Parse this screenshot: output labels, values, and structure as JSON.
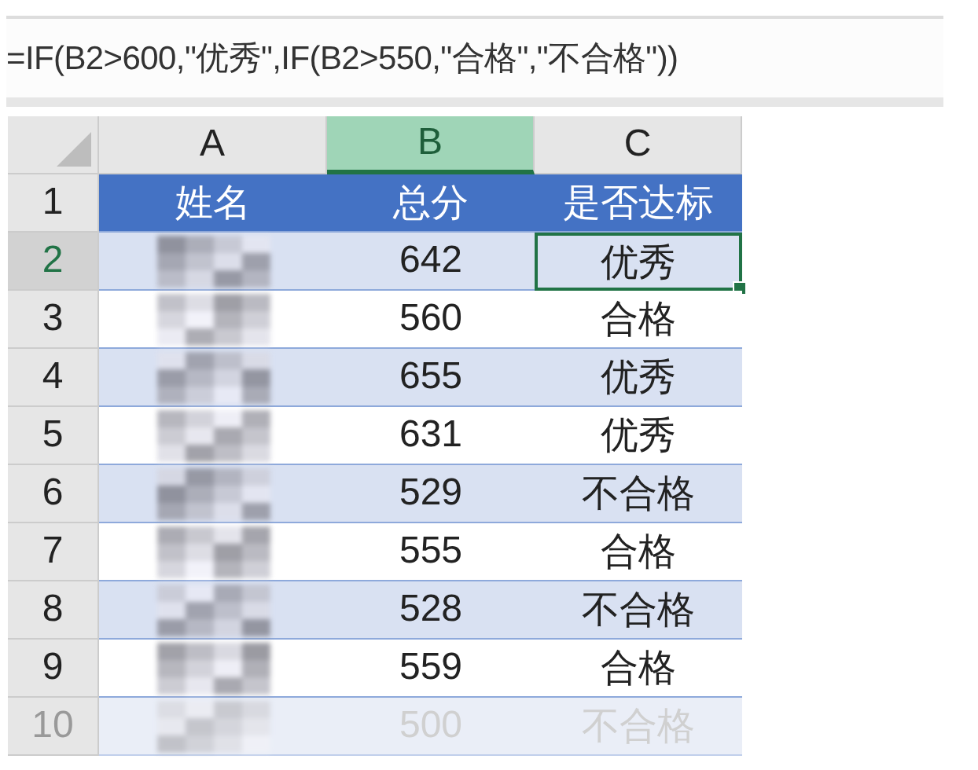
{
  "formula_bar": {
    "formula": "=IF(B2>600,\"优秀\",IF(B2>550,\"合格\",\"不合格\"))"
  },
  "columns": [
    {
      "label": "A",
      "selected": false
    },
    {
      "label": "B",
      "selected": true
    },
    {
      "label": "C",
      "selected": false
    }
  ],
  "header_row": {
    "number": "1",
    "cells": [
      "姓名",
      "总分",
      "是否达标"
    ]
  },
  "rows": [
    {
      "number": "2",
      "name_blurred": true,
      "score": "642",
      "result": "优秀",
      "selected": true,
      "faded": false
    },
    {
      "number": "3",
      "name_blurred": true,
      "score": "560",
      "result": "合格",
      "selected": false,
      "faded": false
    },
    {
      "number": "4",
      "name_blurred": true,
      "score": "655",
      "result": "优秀",
      "selected": false,
      "faded": false
    },
    {
      "number": "5",
      "name_blurred": true,
      "score": "631",
      "result": "优秀",
      "selected": false,
      "faded": false
    },
    {
      "number": "6",
      "name_blurred": true,
      "score": "529",
      "result": "不合格",
      "selected": false,
      "faded": false
    },
    {
      "number": "7",
      "name_blurred": true,
      "score": "555",
      "result": "合格",
      "selected": false,
      "faded": false
    },
    {
      "number": "8",
      "name_blurred": true,
      "score": "528",
      "result": "不合格",
      "selected": false,
      "faded": false
    },
    {
      "number": "9",
      "name_blurred": true,
      "score": "559",
      "result": "合格",
      "selected": false,
      "faded": false
    },
    {
      "number": "10",
      "name_blurred": true,
      "score": "500",
      "result": "不合格",
      "selected": false,
      "faded": true
    }
  ]
}
